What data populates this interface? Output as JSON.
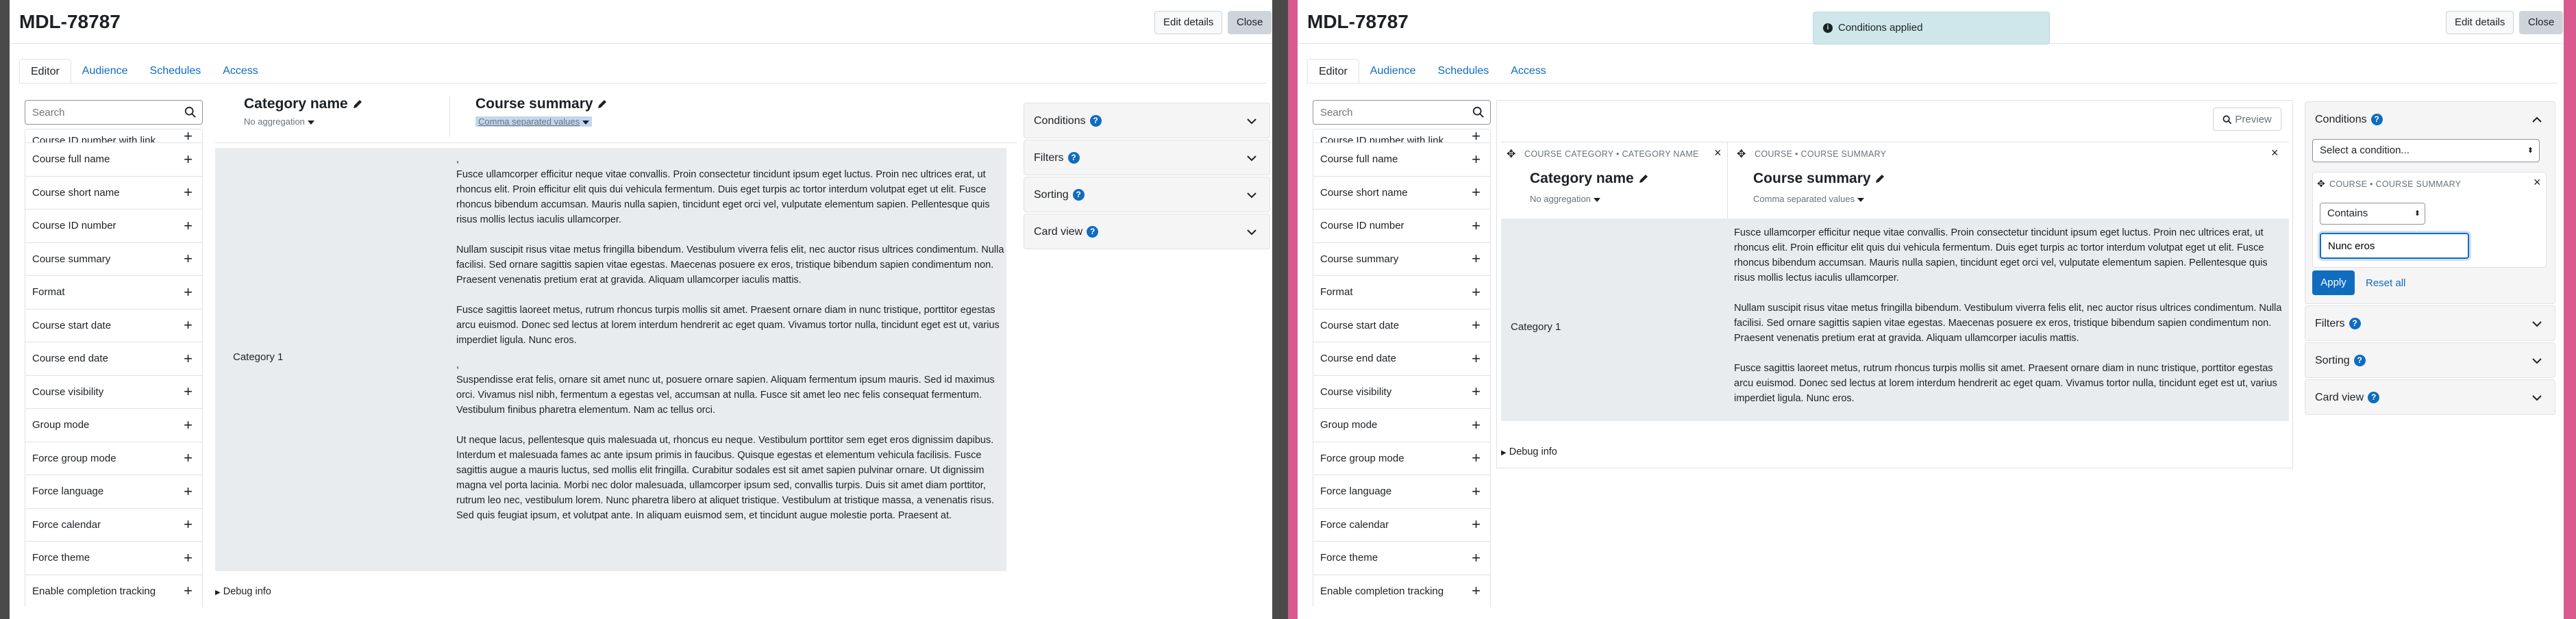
{
  "app": {
    "title": "MDL-78787",
    "edit_details": "Edit details",
    "close": "Close"
  },
  "tabs": [
    "Editor",
    "Audience",
    "Schedules",
    "Access"
  ],
  "search": {
    "placeholder": "Search"
  },
  "sidebar_items_left": [
    "Course ID number with link",
    "Course full name",
    "Course short name",
    "Course ID number",
    "Course summary",
    "Format",
    "Course start date",
    "Course end date",
    "Course visibility",
    "Group mode",
    "Force group mode",
    "Force language",
    "Force calendar",
    "Force theme",
    "Enable completion tracking"
  ],
  "sidebar_items_right": [
    "Course ID number with link",
    "Course full name",
    "Course short name",
    "Course ID number",
    "Course summary",
    "Format",
    "Course start date",
    "Course end date",
    "Course visibility",
    "Group mode",
    "Force group mode",
    "Force language",
    "Force calendar",
    "Force theme",
    "Enable completion tracking"
  ],
  "columns": {
    "col1": {
      "header": "COURSE CATEGORY • CATEGORY NAME",
      "title": "Category name",
      "aggregation": "No aggregation"
    },
    "col2": {
      "header": "COURSE • COURSE SUMMARY",
      "title": "Course summary",
      "aggregation": "Comma separated values"
    }
  },
  "row": {
    "category": "Category 1"
  },
  "summary_left": {
    "comma1": ",",
    "p1": "Fusce ullamcorper efficitur neque vitae convallis. Proin consectetur tincidunt ipsum eget luctus. Proin nec ultrices erat, ut rhoncus elit. Proin efficitur elit quis dui vehicula fermentum. Duis eget turpis ac tortor interdum volutpat eget ut elit. Fusce rhoncus bibendum accumsan. Mauris nulla sapien, tincidunt eget orci vel, vulputate elementum sapien. Pellentesque quis risus mollis lectus iaculis ullamcorper.",
    "p2": "Nullam suscipit risus vitae metus fringilla bibendum. Vestibulum viverra felis elit, nec auctor risus ultrices condimentum. Nulla facilisi. Sed ornare sagittis sapien vitae egestas. Maecenas posuere ex eros, tristique bibendum sapien condimentum non. Praesent venenatis pretium erat at gravida. Aliquam ullamcorper iaculis mattis.",
    "p3": "Fusce sagittis laoreet metus, rutrum rhoncus turpis mollis sit amet. Praesent ornare diam in nunc tristique, porttitor egestas arcu euismod. Donec sed lectus at lorem interdum hendrerit ac eget quam. Vivamus tortor nulla, tincidunt eget est ut, varius imperdiet ligula. Nunc eros.",
    "comma2": ",",
    "p4": "Suspendisse erat felis, ornare sit amet nunc ut, posuere ornare sapien. Aliquam fermentum ipsum mauris. Sed id maximus orci. Vivamus nisl nibh, fermentum a egestas vel, accumsan at nulla. Fusce sit amet leo nec felis consequat fermentum. Vestibulum finibus pharetra elementum. Nam ac tellus orci.",
    "p5": "Ut neque lacus, pellentesque quis malesuada ut, rhoncus eu neque. Vestibulum porttitor sem eget eros dignissim dapibus. Interdum et malesuada fames ac ante ipsum primis in faucibus. Quisque egestas et elementum vehicula facilisis. Fusce sagittis augue a mauris luctus, sed mollis elit fringilla. Curabitur sodales est sit amet sapien pulvinar ornare. Ut dignissim magna vel porta lacinia. Morbi nec dolor malesuada, ullamcorper ipsum sed, convallis turpis. Duis sit amet diam porttitor, rutrum leo nec, vestibulum lorem. Nunc pharetra libero at aliquet tristique. Vestibulum at tristique massa, a venenatis risus. Sed quis feugiat ipsum, et volutpat ante. In aliquam euismod sem, et tincidunt augue molestie porta. Praesent at."
  },
  "summary_right": {
    "p1": "Fusce ullamcorper efficitur neque vitae convallis. Proin consectetur tincidunt ipsum eget luctus. Proin nec ultrices erat, ut rhoncus elit. Proin efficitur elit quis dui vehicula fermentum. Duis eget turpis ac tortor interdum volutpat eget ut elit. Fusce rhoncus bibendum accumsan. Mauris nulla sapien, tincidunt eget orci vel, vulputate elementum sapien. Pellentesque quis risus mollis lectus iaculis ullamcorper.",
    "p2": "Nullam suscipit risus vitae metus fringilla bibendum. Vestibulum viverra felis elit, nec auctor risus ultrices condimentum. Nulla facilisi. Sed ornare sagittis sapien vitae egestas. Maecenas posuere ex eros, tristique bibendum sapien condimentum non. Praesent venenatis pretium erat at gravida. Aliquam ullamcorper iaculis mattis.",
    "p3": "Fusce sagittis laoreet metus, rutrum rhoncus turpis mollis sit amet. Praesent ornare diam in nunc tristique, porttitor egestas arcu euismod. Donec sed lectus at lorem interdum hendrerit ac eget quam. Vivamus tortor nulla, tincidunt eget est ut, varius imperdiet ligula. Nunc eros."
  },
  "debug": "Debug info",
  "preview_button": "Preview",
  "toast": "Conditions applied",
  "panels": {
    "conditions": "Conditions",
    "filters": "Filters",
    "sorting": "Sorting",
    "card_view": "Card view"
  },
  "conditions_panel": {
    "select_placeholder": "Select a condition...",
    "item_header": "COURSE • COURSE SUMMARY",
    "operator": "Contains",
    "value": "Nunc eros",
    "apply": "Apply",
    "reset": "Reset all"
  },
  "icons": {
    "search": "search-icon",
    "plus": "plus-icon",
    "pencil": "pencil-icon",
    "chevron": "chevron-down-icon",
    "close": "close-icon",
    "move": "move-icon",
    "info": "info-icon"
  },
  "colors": {
    "accent": "#0f6cbf",
    "toast": "#cfe7ea"
  }
}
